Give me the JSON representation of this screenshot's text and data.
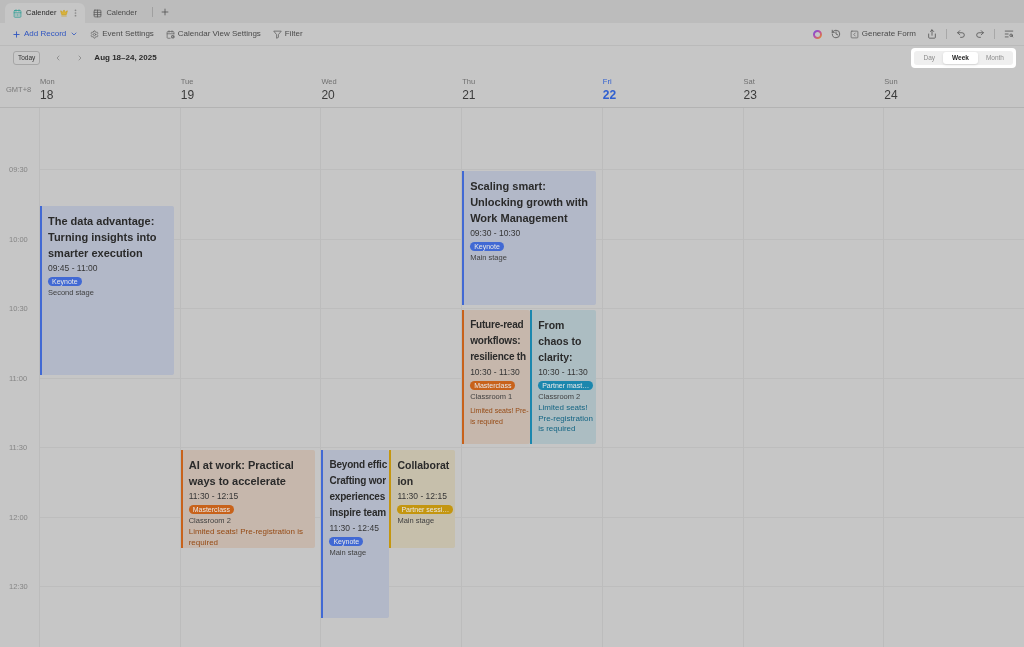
{
  "tabs": [
    {
      "label": "Calender",
      "kind": "calendar",
      "selected": true,
      "crowned": true
    },
    {
      "label": "Calender",
      "kind": "grid",
      "selected": false,
      "crowned": false
    }
  ],
  "toolbar": {
    "left": [
      {
        "label": "Add Record",
        "kind": "add"
      },
      {
        "label": "Event Settings",
        "kind": "event_settings"
      },
      {
        "label": "Calendar View Settings",
        "kind": "view_settings"
      },
      {
        "label": "Filter",
        "kind": "filter"
      }
    ],
    "right": [
      {
        "label": "Generate Form",
        "kind": "form"
      }
    ]
  },
  "navigation": {
    "today_button": "Today",
    "range": "Aug 18–24, 2025"
  },
  "view_switcher": {
    "highlighted": true,
    "options": [
      {
        "label": "Day",
        "selected": false
      },
      {
        "label": "Week",
        "selected": true
      },
      {
        "label": "Month",
        "selected": false
      }
    ]
  },
  "calendar": {
    "timezone": "GMT+8",
    "time_labels": [
      "09:30",
      "10:00",
      "10:30",
      "11:00",
      "11:30",
      "12:00",
      "12:30"
    ],
    "days": [
      {
        "weekday": "Mon",
        "date": "18",
        "today": false,
        "events": [
          {
            "title": "The data advantage: Turning insights into smarter execution",
            "time": "09:45 - 11:00",
            "tag": "Keynote",
            "color": "#4169d4",
            "location": "Second stage"
          }
        ]
      },
      {
        "weekday": "Tue",
        "date": "19",
        "today": false,
        "events": [
          {
            "title": "AI at work: Practical ways to accelerate",
            "time": "11:30 - 12:15",
            "tag": "Masterclass",
            "color": "#c8621a",
            "location": "Classroom 2",
            "note": "Limited seats! Pre-registration is required"
          }
        ]
      },
      {
        "weekday": "Wed",
        "date": "20",
        "today": false,
        "events": [
          {
            "title_lines": [
              "Beyond effic",
              "Crafting wor",
              "experiences",
              "inspire team"
            ],
            "time": "11:30 - 12:45",
            "tag": "Keynote",
            "color": "#4169d4",
            "location": "Main stage"
          },
          {
            "title": "Collaboration",
            "time": "11:30 - 12:15",
            "tag": "Partner sessi…",
            "color": "#c4960f",
            "location": "Main stage"
          }
        ]
      },
      {
        "weekday": "Thu",
        "date": "21",
        "today": false,
        "events": [
          {
            "title": "Scaling smart: Unlocking growth with Work Management",
            "time": "09:30 - 10:30",
            "tag": "Keynote",
            "color": "#4169d4",
            "location": "Main stage"
          },
          {
            "title_lines": [
              "Future-read",
              "workflows:",
              "resilience th"
            ],
            "time": "10:30 - 11:30",
            "tag": "Masterclass",
            "color": "#c8621a",
            "location": "Classroom 1",
            "note_lines": [
              "Limited seats! Pre-",
              "is required"
            ]
          },
          {
            "title": "From chaos to clarity:",
            "time": "10:30 - 11:30",
            "tag": "Partner mast…",
            "color": "#1b87ae",
            "location": "Classroom 2",
            "note": "Limited seats! Pre-registration is required"
          }
        ]
      },
      {
        "weekday": "Fri",
        "date": "22",
        "today": true
      },
      {
        "weekday": "Sat",
        "date": "23",
        "today": false
      },
      {
        "weekday": "Sun",
        "date": "24",
        "today": false
      }
    ]
  }
}
